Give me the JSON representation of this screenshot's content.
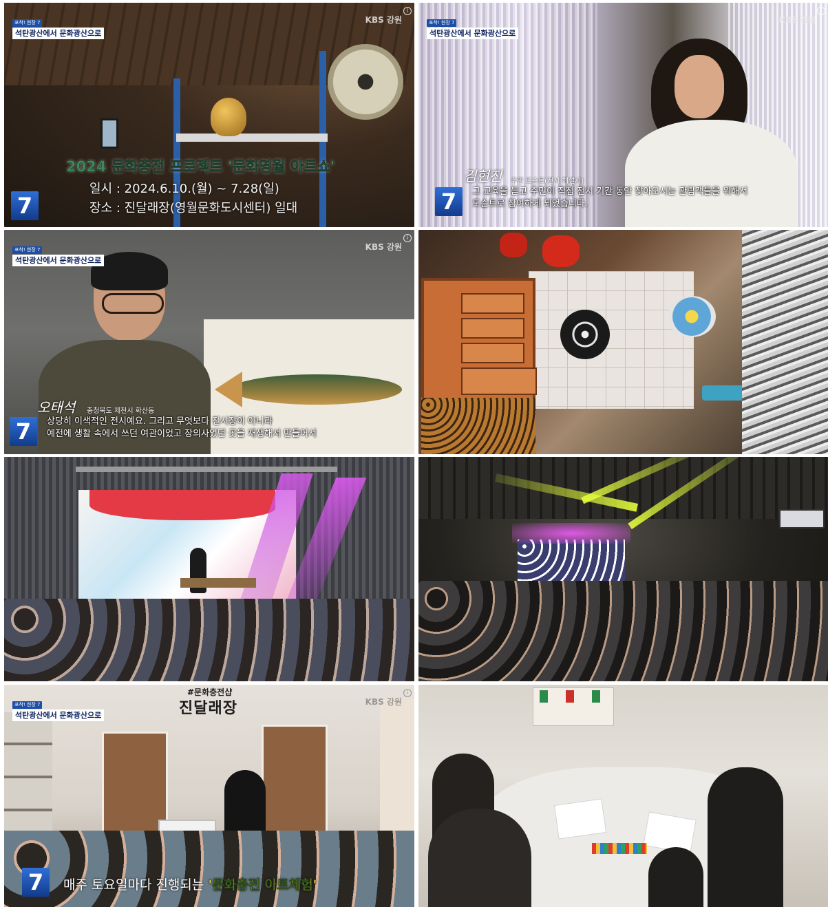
{
  "common": {
    "badge_small": "포착! 현장 7",
    "badge_main": "석탄광산에서 문화광산으로",
    "broadcaster": "KBS 강원",
    "info_glyph": "i",
    "channel_number": "7"
  },
  "panels": [
    {
      "title": "2024 문화충전 프로젝트 '문화영월 아트쇼'",
      "date_line": "일시 : 2024.6.10.(월) ~ 7.28(일)",
      "place_line": "장소 : 진달래장(영월문화도시센터) 일대"
    },
    {
      "speaker_signature": "김현진",
      "speaker_meta": "주민 도슨트(전시 해설사)",
      "caption_line1": "그 교육을 듣고 주민이 직접 전시 기간 동안 찾아오시는 관람객들을 위해서",
      "caption_line2": "도슨트로 참여하게 되었습니다."
    },
    {
      "speaker_signature": "오태석",
      "speaker_meta": "충청북도 제천시 화산동",
      "caption_line1": "상당히 이색적인 전시예요. 그리고 무엇보다 전시장이 아니라",
      "caption_line2": "예전에 생활 속에서 쓰던 여관이었고 장의사였던 곳을 재생해서 만들어서"
    },
    {},
    {},
    {},
    {
      "hashtag": "#문화충전샵",
      "sign": "진달래장",
      "caption_normal": "매주 토요일마다 진행되는 ",
      "caption_highlight": "'문화충전 아트체험'"
    },
    {}
  ]
}
